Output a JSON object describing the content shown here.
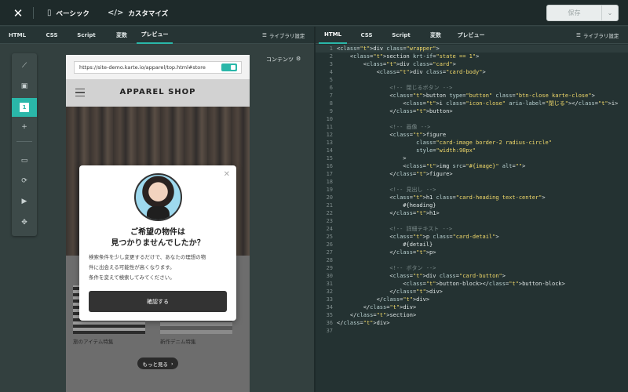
{
  "topbar": {
    "close_icon": "close-icon",
    "basic_label": "ベーシック",
    "customize_label": "カスタマイズ",
    "save_label": "保存",
    "save_dropdown_icon": "chevron-down-icon"
  },
  "left_tabs": [
    "HTML",
    "CSS",
    "Script",
    "変数",
    "プレビュー"
  ],
  "left_active_tab": "プレビュー",
  "right_tabs": [
    "HTML",
    "CSS",
    "Script",
    "変数",
    "プレビュー"
  ],
  "right_active_tab": "HTML",
  "library_settings_label": "ライブラリ設定",
  "toolbar": {
    "items": [
      "slash-icon",
      "layout-icon",
      "step-1",
      "plus-icon",
      "device-icon",
      "rotate-icon",
      "play-icon",
      "fullscreen-icon"
    ],
    "active_step": "1"
  },
  "contents_label": "コンテンツ",
  "preview": {
    "url": "https://site-demo.karte.io/apparel/top.html#store",
    "shop_title": "APPAREL SHOP",
    "cards": [
      "旅のアイテム特集",
      "新作デニム特集"
    ],
    "more_label": "もっと見る",
    "modal": {
      "heading_line1": "ご希望の物件は",
      "heading_line2": "見つかりませんでしたか？",
      "detail_line1": "検索条件を少し変更するだけで、あなたの理想の物",
      "detail_line2": "件に出会える可能性が高くなります。",
      "detail_line3": "条件を変えて検索してみてください。",
      "button_label": "確認する"
    }
  },
  "code_lines": [
    "<div class=\"wrapper\">",
    "    <section krt-if=\"state == 1\">",
    "        <div class=\"card\">",
    "            <div class=\"card-body\">",
    "",
    "                <!-- 閉じるボタン -->",
    "                <button type=\"button\" class=\"btn-close karte-close\">",
    "                    <i class=\"icon-close\" aria-label=\"閉じる\"></i>",
    "                </button>",
    "",
    "                <!-- 画像 -->",
    "                <figure",
    "                        class=\"card-image border-2 radius-circle\"",
    "                        style=\"width:98px\"",
    "                    >",
    "                    <img src=\"#{image}\" alt=\"\">",
    "                </figure>",
    "",
    "                <!-- 見出し -->",
    "                <h1 class=\"card-heading text-center\">",
    "                    #{heading}",
    "                </h1>",
    "",
    "                <!-- 詳細テキスト -->",
    "                <p class=\"card-detail\">",
    "                    #{detail}",
    "                </p>",
    "",
    "                <!-- ボタン -->",
    "                <div class=\"card-button\">",
    "                    <button-block></button-block>",
    "                </div>",
    "            </div>",
    "        </div>",
    "    </section>",
    "</div>",
    ""
  ]
}
